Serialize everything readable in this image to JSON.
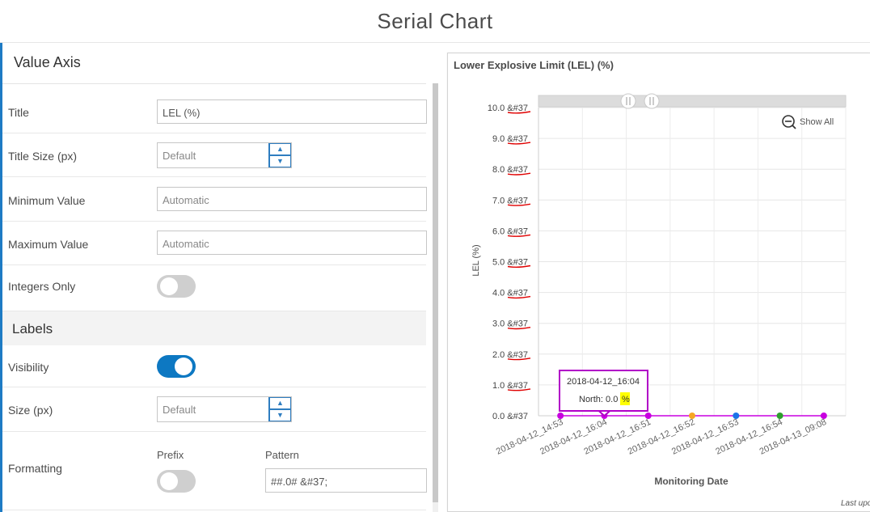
{
  "page": {
    "title": "Serial Chart"
  },
  "value_axis": {
    "section_title": "Value Axis",
    "title": {
      "label": "Title",
      "value": "LEL (%)"
    },
    "title_size": {
      "label": "Title Size (px)",
      "placeholder": "Default"
    },
    "minimum": {
      "label": "Minimum Value",
      "placeholder": "Automatic"
    },
    "maximum": {
      "label": "Maximum Value",
      "placeholder": "Automatic"
    },
    "integers_only": {
      "label": "Integers Only",
      "checked": false
    }
  },
  "labels": {
    "section_title": "Labels",
    "visibility": {
      "label": "Visibility",
      "checked": true
    },
    "size": {
      "label": "Size (px)",
      "placeholder": "Default"
    },
    "formatting": {
      "label": "Formatting",
      "prefix_label": "Prefix",
      "prefix_checked": false,
      "pattern_label": "Pattern",
      "pattern_value": "##.0# &#37;"
    }
  },
  "chart_panel": {
    "title": "Lower Explosive Limit (LEL) (%)",
    "show_all": "Show All",
    "show_all_icon": "zoom-out-icon",
    "last_updated": "Last upd"
  },
  "chart_data": {
    "type": "line",
    "ylabel": "LEL (%)",
    "xlabel": "Monitoring Date",
    "ylim": [
      0,
      10
    ],
    "y_ticks": [
      "0.0 &#37",
      "1.0 &#37",
      "2.0 &#37",
      "3.0 &#37",
      "4.0 &#37",
      "5.0 &#37",
      "6.0 &#37",
      "7.0 &#37",
      "8.0 &#37",
      "9.0 &#37",
      "10.0 &#37"
    ],
    "categories": [
      "2018-04-12_14:53",
      "2018-04-12_16:04",
      "2018-04-12_16:51",
      "2018-04-12_16:52",
      "2018-04-12_16:53",
      "2018-04-12_16:54",
      "2018-04-13_09:08"
    ],
    "values": [
      0,
      0,
      0,
      0,
      0,
      0,
      0
    ],
    "point_colors": [
      "#c800e0",
      "#c800e0",
      "#c800e0",
      "#f5a623",
      "#1a73e8",
      "#2e9e2e",
      "#c800e0"
    ],
    "grid": true,
    "tooltip": {
      "title": "2018-04-12_16:04",
      "series": "North",
      "value_text": "0.0",
      "unit": "%"
    }
  }
}
